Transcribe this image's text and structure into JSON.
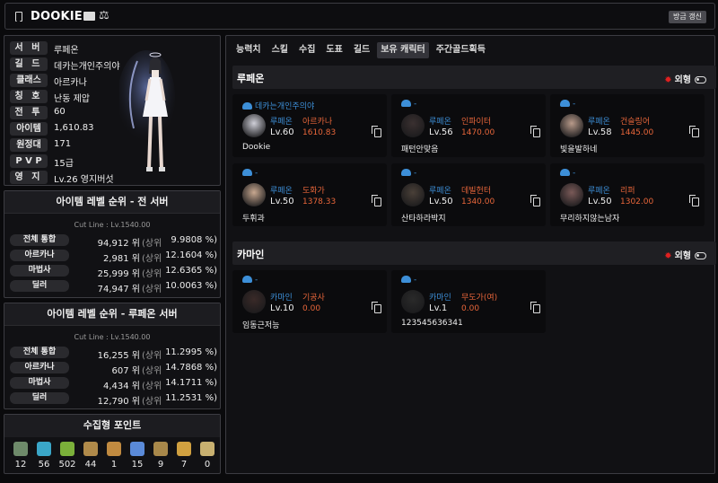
{
  "header": {
    "title": "DOOKIE",
    "refresh_label": "방금 갱신"
  },
  "profile": {
    "rows": [
      {
        "label": "서 버",
        "value": "루페온"
      },
      {
        "label": "길 드",
        "value": "데카는개인주의야"
      },
      {
        "label": "클래스",
        "value": "아르카나"
      },
      {
        "label": "칭 호",
        "value": "난동 제압"
      },
      {
        "label": "전 투",
        "value": "60"
      },
      {
        "label": "아이템",
        "value": "1,610.83"
      },
      {
        "label": "원정대",
        "value": "171"
      },
      {
        "label": "P V P",
        "value": "15급"
      },
      {
        "label": "영 지",
        "value": "Lv.26 영지버섯"
      }
    ]
  },
  "rank_all": {
    "title": "아이템 레벨 순위 - 전 서버",
    "cutline": "Cut Line : Lv.1540.00",
    "rows": [
      {
        "label": "전체 통합",
        "value": "94,912 위",
        "sub": "(상위",
        "pct": "9.9808 %)"
      },
      {
        "label": "아르카나",
        "value": "2,981 위",
        "sub": "(상위",
        "pct": "12.1604 %)"
      },
      {
        "label": "마법사",
        "value": "25,999 위",
        "sub": "(상위",
        "pct": "12.6365 %)"
      },
      {
        "label": "딜러",
        "value": "74,947 위",
        "sub": "(상위",
        "pct": "10.0063 %)"
      }
    ]
  },
  "rank_server": {
    "title": "아이템 레벨 순위 - 루페온 서버",
    "cutline": "Cut Line : Lv.1540.00",
    "rows": [
      {
        "label": "전체 통합",
        "value": "16,255 위",
        "sub": "(상위",
        "pct": "11.2995 %)"
      },
      {
        "label": "아르카나",
        "value": "607 위",
        "sub": "(상위",
        "pct": "14.7868 %)"
      },
      {
        "label": "마법사",
        "value": "4,434 위",
        "sub": "(상위",
        "pct": "14.1711 %)"
      },
      {
        "label": "딜러",
        "value": "12,790 위",
        "sub": "(상위",
        "pct": "11.2531 %)"
      }
    ]
  },
  "collection": {
    "title": "수집형 포인트",
    "items": [
      {
        "icon": "mokoko-seed-icon",
        "count": "12",
        "color": "#6e8a6a"
      },
      {
        "icon": "island-heart-icon",
        "count": "56",
        "color": "#3aa6c8"
      },
      {
        "icon": "giant-heart-icon",
        "count": "502",
        "color": "#7bb03a"
      },
      {
        "icon": "art-piece-icon",
        "count": "44",
        "color": "#b08a4a"
      },
      {
        "icon": "adventure-tome-icon",
        "count": "1",
        "color": "#c08a40"
      },
      {
        "icon": "ignea-token-icon",
        "count": "15",
        "color": "#5a8ad8"
      },
      {
        "icon": "sea-bounty-icon",
        "count": "9",
        "color": "#a8884a"
      },
      {
        "icon": "world-tree-leaf-icon",
        "count": "7",
        "color": "#d0a040"
      },
      {
        "icon": "orpheus-star-icon",
        "count": "0",
        "color": "#c8b070"
      }
    ]
  },
  "tabs": [
    "능력치",
    "스킬",
    "수집",
    "도표",
    "길드",
    "보유 캐릭터",
    "주간골드획득"
  ],
  "active_tab": 5,
  "servers": [
    {
      "name": "루페온",
      "toggle_label": "외형",
      "characters": [
        {
          "guild": "데카는개인주의야",
          "server": "루페온",
          "class": "아르카나",
          "level": "Lv.60",
          "ilvl": "1610.83",
          "name": "Dookie",
          "portrait": "#cfcfd8"
        },
        {
          "guild": "-",
          "server": "루페온",
          "class": "인파이터",
          "level": "Lv.56",
          "ilvl": "1470.00",
          "name": "패턴안맞음",
          "portrait": "#3a3030"
        },
        {
          "guild": "-",
          "server": "루페온",
          "class": "건슬링어",
          "level": "Lv.58",
          "ilvl": "1445.00",
          "name": "빛을발하네",
          "portrait": "#b89a8a"
        },
        {
          "guild": "-",
          "server": "루페온",
          "class": "도화가",
          "level": "Lv.50",
          "ilvl": "1378.33",
          "name": "두휘과",
          "portrait": "#c8a890"
        },
        {
          "guild": "-",
          "server": "루페온",
          "class": "데빌헌터",
          "level": "Lv.50",
          "ilvl": "1340.00",
          "name": "산타하라박지",
          "portrait": "#4a4038"
        },
        {
          "guild": "-",
          "server": "루페온",
          "class": "리퍼",
          "level": "Lv.50",
          "ilvl": "1302.00",
          "name": "무리하지않는남자",
          "portrait": "#7a5a58"
        }
      ]
    },
    {
      "name": "카마인",
      "toggle_label": "외형",
      "characters": [
        {
          "guild": "-",
          "server": "카마인",
          "class": "기공사",
          "level": "Lv.10",
          "ilvl": "0.00",
          "name": "임동근저능",
          "portrait": "#3a2a28"
        },
        {
          "guild": "-",
          "server": "카마인",
          "class": "무도가(여)",
          "level": "Lv.1",
          "ilvl": "0.00",
          "name": "123545636341",
          "portrait": "#2a2a2a"
        }
      ]
    }
  ]
}
